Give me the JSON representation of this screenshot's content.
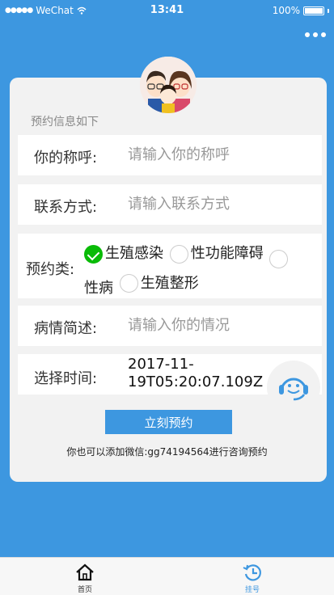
{
  "status_bar": {
    "carrier": "WeChat",
    "time": "13:41",
    "battery": "100%"
  },
  "form": {
    "section_title": "预约信息如下",
    "name": {
      "label": "你的称呼:",
      "placeholder": "请输入你的称呼"
    },
    "contact": {
      "label": "联系方式:",
      "placeholder": "请输入联系方式"
    },
    "category": {
      "label": "预约类:",
      "options": [
        {
          "label": "生殖感染",
          "checked": true
        },
        {
          "label": "性功能障碍",
          "checked": false
        },
        {
          "label": "性病",
          "checked": false
        },
        {
          "label": "生殖整形",
          "checked": false
        }
      ]
    },
    "condition": {
      "label": "病情简述:",
      "placeholder": "请输入你的情况"
    },
    "time": {
      "label": "选择时间:",
      "value": "2017-11-19T05:20:07.109Z"
    },
    "submit_label": "立刻预约",
    "wechat_note": "你也可以添加微信:gg74194564进行咨询预约"
  },
  "tabbar": {
    "home_label": "首页",
    "register_label": "挂号"
  },
  "colors": {
    "primary": "#3d97e0",
    "checked": "#09bb07"
  }
}
